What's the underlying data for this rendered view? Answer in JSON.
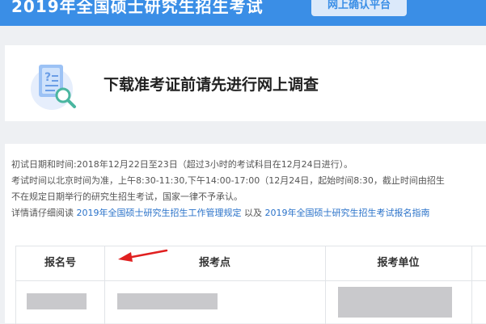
{
  "banner": {
    "title": "2019年全国硕士研究生招生考试",
    "badge": "网上确认平台",
    "color": "#3a8ee6"
  },
  "survey": {
    "icon": "document-magnifier-icon",
    "title": "下载准考证前请先进行网上调查"
  },
  "info": {
    "line1": "初试日期和时间:2018年12月22日至23日（超过3小时的考试科目在12月24日进行）。",
    "line2": "考试时间以北京时间为准，上午8:30-11:30,下午14:00-17:00（12月24日，起始时间8:30，截止时间由招生",
    "line3": "不在规定日期举行的研究生招生考试，国家一律不予承认。",
    "line4_prefix": "详情请仔细阅读",
    "link1": "2019年全国硕士研究生招生工作管理规定",
    "line4_mid": "以及",
    "link2": "2019年全国硕士研究生招生考试报名指南"
  },
  "table": {
    "headers": [
      "报名号",
      "报考点",
      "报考单位"
    ]
  },
  "annotation": {
    "arrow_icon": "red-arrow-icon",
    "arrow_color": "#e02020"
  }
}
